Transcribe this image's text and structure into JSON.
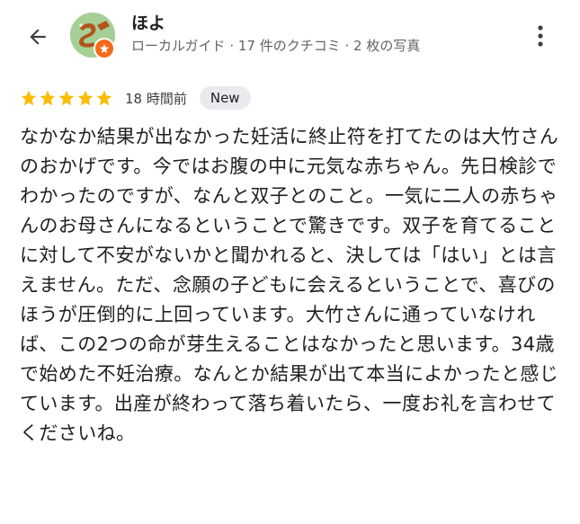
{
  "header": {
    "back_icon": "arrow-back-icon",
    "avatar_icon": "avatar-illustration",
    "badge_icon": "local-guide-star-icon",
    "user_name": "ほよ",
    "user_meta": "ローカルガイド · 17 件のクチコミ · 2 枚の写真",
    "more_icon": "more-vert-icon"
  },
  "review": {
    "rating": 5,
    "max_rating": 5,
    "time": "18 時間前",
    "new_label": "New",
    "text": "なかなか結果が出なかった妊活に終止符を打てたのは大竹さんのおかげです。今ではお腹の中に元気な赤ちゃん。先日検診でわかったのですが、なんと双子とのこと。一気に二人の赤ちゃんのお母さんになるということで驚きです。双子を育てることに対して不安がないかと聞かれると、決しては「はい」とは言えません。ただ、念願の子どもに会えるということで、喜びのほうが圧倒的に上回っています。大竹さんに通っていなければ、この2つの命が芽生えることはなかったと思います。34歳で始めた不妊治療。なんとか結果が出て本当によかったと感じています。出産が終わって落ち着いたら、一度お礼を言わせてくださいね。"
  },
  "colors": {
    "star": "#fbbc04",
    "badge": "#f26b1d",
    "avatar_bg": "#a6cf95",
    "new_badge_bg": "#e8eaed"
  }
}
